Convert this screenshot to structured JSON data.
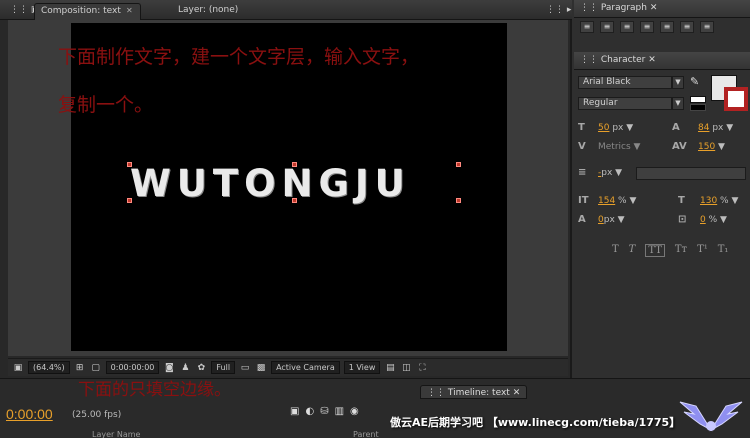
{
  "comp_tabbar": {
    "comp_tab": "Composition: text",
    "layer_tab": "Layer: (none)"
  },
  "stage": {
    "text": "WUTONGJU",
    "note_line1": "下面制作文字，建一个文字层，输入文字，",
    "note_line2": "复制一个。",
    "note_bottom": "下面的只填空边缘。"
  },
  "viewer_toolbar": {
    "zoom": "(64.4%)",
    "timecode": "0:00:00:00",
    "resolution": "Full",
    "camera": "Active Camera",
    "views": "1 View"
  },
  "paragraph": {
    "title": "Paragraph"
  },
  "character": {
    "title": "Character",
    "font_family": "Arial Black",
    "font_style": "Regular",
    "font_size": "50",
    "font_size_unit": "px",
    "leading": "84",
    "leading_unit": "px",
    "kerning": "Metrics",
    "tracking": "150",
    "stroke_width": "-",
    "stroke_unit": "px",
    "vertical_scale": "154",
    "horizontal_scale": "130",
    "baseline_shift": "0",
    "baseline_unit": "px",
    "tsume": "0",
    "fill_color": "#e8e8e8",
    "stroke_color": "#000000"
  },
  "timeline": {
    "tab": "Timeline: text",
    "timecode": "0:00:00",
    "fps": "(25.00 fps)",
    "col_layer_name": "Layer Name",
    "col_parent": "Parent"
  },
  "watermark": "傲云AE后期学习吧 【www.linecg.com/tieba/1775】"
}
